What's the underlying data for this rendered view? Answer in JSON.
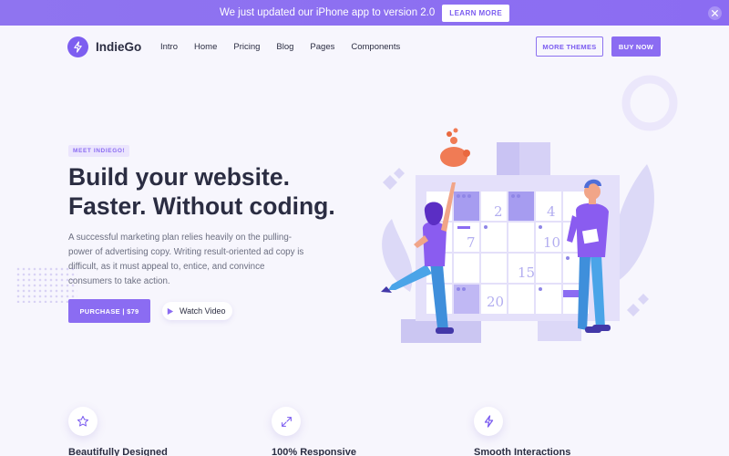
{
  "announcement": {
    "message": "We just updated our iPhone app to version 2.0",
    "button": "LEARN MORE"
  },
  "brand": {
    "name": "IndieGo"
  },
  "nav": {
    "items": [
      "Intro",
      "Home",
      "Pricing",
      "Blog",
      "Pages",
      "Components"
    ],
    "more_themes": "MORE THEMES",
    "buy_now": "BUY NOW"
  },
  "hero": {
    "tag": "MEET INDIEGO!",
    "headline_line1": "Build your website.",
    "headline_line2": "Faster. Without coding.",
    "description": "A successful marketing plan relies heavily on the pulling-power of advertising copy. Writing result-oriented ad copy is difficult, as it must appeal to, entice, and convince consumers to take action.",
    "purchase_button": "PURCHASE  |  $79",
    "watch_video": "Watch Video"
  },
  "illustration": {
    "calendar_numbers": [
      "2",
      "4",
      "7",
      "10",
      "15",
      "20"
    ]
  },
  "features": [
    {
      "title": "Beautifully Designed",
      "icon": "star-icon"
    },
    {
      "title": "100% Responsive",
      "icon": "expand-icon"
    },
    {
      "title": "Smooth Interactions",
      "icon": "bolt-icon"
    }
  ],
  "colors": {
    "accent": "#8b6cf2",
    "background": "#f7f6fd",
    "heading": "#2b2d42"
  }
}
